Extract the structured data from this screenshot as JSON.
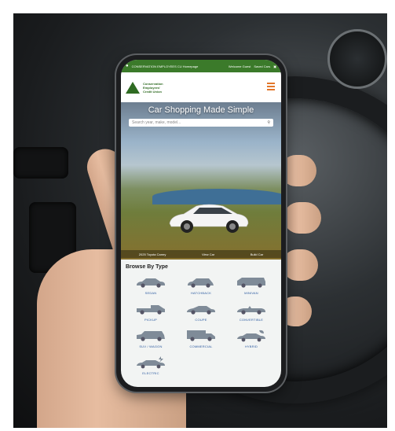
{
  "topbar": {
    "location": "CONSERVATION EMPLOYEES CU Homepage",
    "welcome": "Welcome Guest",
    "saved": "Saved Cars"
  },
  "logo": {
    "line1": "Conservation",
    "line2": "Employees'",
    "line3": "Credit Union"
  },
  "hero": {
    "title": "Car Shopping Made Simple",
    "search_placeholder": "Search year, make, model...",
    "caption_car": "2025 Toyota Camry",
    "caption_view": "View Car",
    "caption_build": "Build Car"
  },
  "browse": {
    "heading": "Browse By Type",
    "types": [
      {
        "label": "SEDAN",
        "icon": "sedan-icon"
      },
      {
        "label": "HATCHBACK",
        "icon": "hatchback-icon"
      },
      {
        "label": "MINIVAN",
        "icon": "minivan-icon"
      },
      {
        "label": "PICKUP",
        "icon": "pickup-icon"
      },
      {
        "label": "COUPE",
        "icon": "coupe-icon"
      },
      {
        "label": "CONVERTIBLE",
        "icon": "convertible-icon"
      },
      {
        "label": "SUV / WAGON",
        "icon": "suv-icon"
      },
      {
        "label": "COMMERCIAL",
        "icon": "commercial-icon"
      },
      {
        "label": "HYBRID",
        "icon": "hybrid-icon"
      },
      {
        "label": "ELECTRIC",
        "icon": "electric-icon"
      }
    ]
  },
  "colors": {
    "brand_green": "#3b7a2a",
    "accent_orange": "#e3772a",
    "link_blue": "#2b5aa0"
  }
}
